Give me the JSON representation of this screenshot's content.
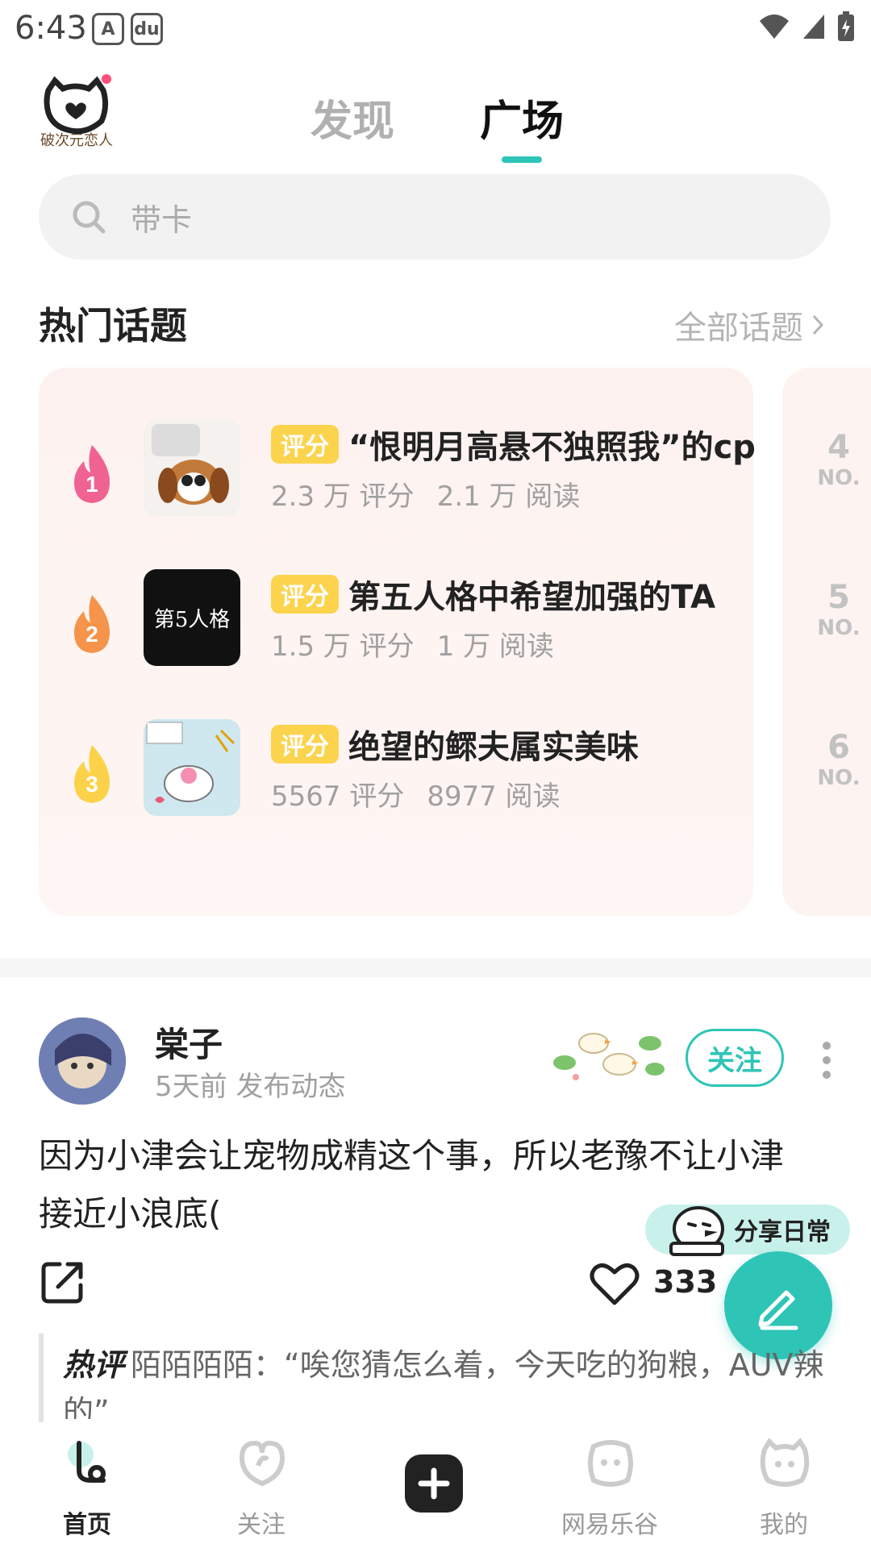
{
  "status_bar": {
    "time": "6:43",
    "app_icon_1": "A",
    "app_icon_2": "du"
  },
  "header": {
    "logo_text": "破次元恋人",
    "tabs": [
      {
        "label": "发现",
        "active": false
      },
      {
        "label": "广场",
        "active": true
      }
    ],
    "accent_color": "#2ec5b6"
  },
  "search": {
    "placeholder": "带卡",
    "icon": "search-icon"
  },
  "hot_topics": {
    "title": "热门话题",
    "all_link": "全部话题",
    "items": [
      {
        "rank": "1",
        "badge": "评分",
        "title": "“恨明月高悬不独照我”的cp",
        "ratings": "2.3 万 评分",
        "reads": "2.1 万 阅读",
        "flame_color": "#f06292"
      },
      {
        "rank": "2",
        "badge": "评分",
        "title": "第五人格中希望加强的TA",
        "ratings": "1.5 万 评分",
        "reads": "1 万 阅读",
        "flame_color": "#f5944a",
        "thumb_text": "第5人格"
      },
      {
        "rank": "3",
        "badge": "评分",
        "title": "绝望的鳏夫属实美味",
        "ratings": "5567 评分",
        "reads": "8977 阅读",
        "flame_color": "#fbd24a"
      }
    ],
    "side_ranks": [
      {
        "num": "4",
        "no": "NO."
      },
      {
        "num": "5",
        "no": "NO."
      },
      {
        "num": "6",
        "no": "NO."
      }
    ]
  },
  "post": {
    "username": "棠子",
    "meta": "5天前 发布动态",
    "follow_label": "关注",
    "text": "因为小津会让宠物成精这个事，所以老豫不让小津接近小浪底(",
    "like_count": "333",
    "share_daily_label": "分享日常",
    "comment_tag": "热评",
    "comment_text": "陌陌陌陌：“唉您猜怎么着，今天吃的狗粮，AUV辣的”"
  },
  "bottom_nav": [
    {
      "label": "首页",
      "icon": "home-icon",
      "active": true
    },
    {
      "label": "关注",
      "icon": "follow-icon",
      "active": false
    },
    {
      "label": "",
      "icon": "add-icon",
      "active": false
    },
    {
      "label": "网易乐谷",
      "icon": "lego-icon",
      "active": false
    },
    {
      "label": "我的",
      "icon": "profile-icon",
      "active": false
    }
  ]
}
